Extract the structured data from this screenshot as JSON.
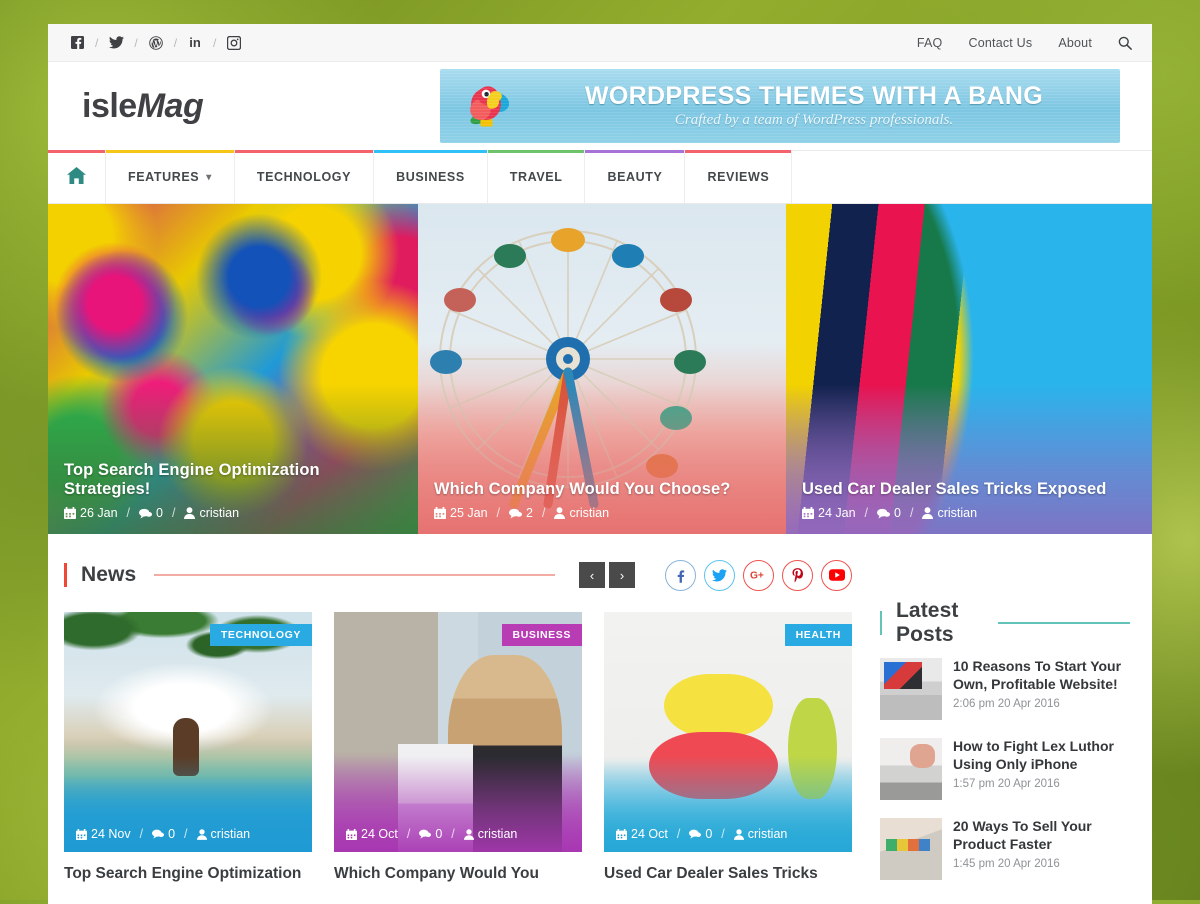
{
  "topbar": {
    "social": [
      {
        "name": "facebook",
        "glyph": "f"
      },
      {
        "name": "twitter",
        "glyph": "t"
      },
      {
        "name": "wordpress",
        "glyph": "w"
      },
      {
        "name": "linkedin",
        "glyph": "in"
      },
      {
        "name": "instagram",
        "glyph": "ig"
      }
    ],
    "separator": "/",
    "links": [
      "FAQ",
      "Contact Us",
      "About"
    ],
    "search_label": "Search"
  },
  "header": {
    "logo_light": "isle",
    "logo_bold": "Mag",
    "ad": {
      "title": "WORDPRESS THEMES WITH A BANG",
      "subtitle": "Crafted by a team of WordPress professionals."
    }
  },
  "nav": {
    "home_label": "Home",
    "items": [
      {
        "label": "FEATURES",
        "color": "#f5c518",
        "caret": "⌄"
      },
      {
        "label": "TECHNOLOGY",
        "color": "#f4626b"
      },
      {
        "label": "BUSINESS",
        "color": "#2ec0f7"
      },
      {
        "label": "TRAVEL",
        "color": "#6cc36c"
      },
      {
        "label": "BEAUTY",
        "color": "#a673d6"
      },
      {
        "label": "REVIEWS",
        "color": "#f4626b"
      }
    ],
    "home_color": "#f4626b"
  },
  "hero": {
    "slides": [
      {
        "title": "Top Search Engine Optimization Strategies!",
        "date": "26 Jan",
        "comments": "0",
        "author": "cristian",
        "image": "rainbow-roses",
        "overlay": "#3c7a3e"
      },
      {
        "title": "Which Company Would You Choose?",
        "date": "25 Jan",
        "comments": "2",
        "author": "cristian",
        "image": "ferris-wheel",
        "overlay": "#e66969"
      },
      {
        "title": "Used Car Dealer Sales Tricks Exposed",
        "date": "24 Jan",
        "comments": "0",
        "author": "cristian",
        "image": "hot-air-balloon",
        "overlay": "#9264ba"
      }
    ]
  },
  "news": {
    "heading": "News",
    "accent": "#ef4836",
    "prev_label": "‹",
    "next_label": "›",
    "social_buttons": [
      {
        "name": "facebook",
        "color": "#8ab4d8"
      },
      {
        "name": "twitter",
        "color": "#5ec3ef"
      },
      {
        "name": "googleplus",
        "color": "#ef5350"
      },
      {
        "name": "pinterest",
        "color": "#ef5350"
      },
      {
        "name": "youtube",
        "color": "#ef5350"
      }
    ],
    "cards": [
      {
        "badge": "TECHNOLOGY",
        "badge_color": "#29aae3",
        "date": "24 Nov",
        "comments": "0",
        "author": "cristian",
        "title": "Top Search Engine Optimization",
        "image": "beach-swing"
      },
      {
        "badge": "BUSINESS",
        "badge_color": "#b83cb4",
        "date": "24 Oct",
        "comments": "0",
        "author": "cristian",
        "title": "Which Company Would You",
        "image": "woman-wall"
      },
      {
        "badge": "HEALTH",
        "badge_color": "#29aae3",
        "date": "24 Oct",
        "comments": "0",
        "author": "cristian",
        "title": "Used Car Dealer Sales Tricks",
        "image": "macarons"
      }
    ]
  },
  "sidebar": {
    "heading": "Latest Posts",
    "accent": "#62c3b8",
    "posts": [
      {
        "title": "10 Reasons To Start Your Own, Profitable Website!",
        "time": "2:06 pm 20 Apr 2016",
        "image": "desk-monitor"
      },
      {
        "title": "How to Fight Lex Luthor Using Only iPhone",
        "time": "1:57 pm 20 Apr 2016",
        "image": "hand-keyboard"
      },
      {
        "title": "20 Ways To Sell Your Product Faster",
        "time": "1:45 pm 20 Apr 2016",
        "image": "color-swatches"
      }
    ]
  }
}
